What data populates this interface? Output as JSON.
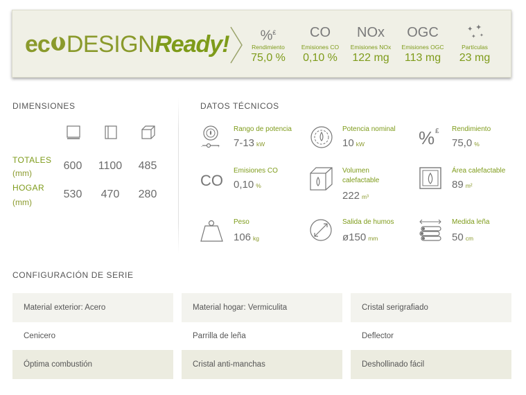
{
  "banner": {
    "logo": {
      "eco": "ec",
      "design": "DESIGN",
      "ready": "Ready!"
    },
    "stats": [
      {
        "symbol": "%",
        "label": "Rendimiento",
        "value": "75,0 %"
      },
      {
        "symbol": "CO",
        "label": "Emisiones CO",
        "value": "0,10 %"
      },
      {
        "symbol": "NOx",
        "label": "Emisiones NOx",
        "value": "122 mg"
      },
      {
        "symbol": "OGC",
        "label": "Emisiones OGC",
        "value": "113 mg"
      },
      {
        "symbol": "",
        "label": "Partículas",
        "value": "23 mg"
      }
    ]
  },
  "dimensions": {
    "title": "DIMENSIONES",
    "rows": [
      {
        "label": "TOTALES",
        "unit": "(mm)",
        "values": [
          "600",
          "1100",
          "485"
        ]
      },
      {
        "label": "HOGAR",
        "unit": "(mm)",
        "values": [
          "530",
          "470",
          "280"
        ]
      }
    ]
  },
  "tech": {
    "title": "DATOS TÉCNICOS",
    "items": [
      {
        "label": "Rango de potencia",
        "value": "7-13",
        "unit": "kW"
      },
      {
        "label": "Potencia nominal",
        "value": "10",
        "unit": "kW"
      },
      {
        "label": "Rendimiento",
        "value": "75,0",
        "unit": "%"
      },
      {
        "label": "Emisiones CO",
        "value": "0,10",
        "unit": "%",
        "symbol": "CO"
      },
      {
        "label": "Volumen calefactable",
        "value": "222",
        "unit": "m³"
      },
      {
        "label": "Área calefactable",
        "value": "89",
        "unit": "m²"
      },
      {
        "label": "Peso",
        "value": "106",
        "unit": "kg"
      },
      {
        "label": "Salida de humos",
        "value": "ø150",
        "unit": "mm"
      },
      {
        "label": "Medida leña",
        "value": "50",
        "unit": "cm"
      }
    ]
  },
  "config": {
    "title": "CONFIGURACIÓN DE SERIE",
    "items": [
      "Material exterior: Acero",
      "Material hogar: Vermiculita",
      "Cristal serigrafiado",
      "Cenicero",
      "Parrilla de leña",
      "Deflector",
      "Óptima combustión",
      "Cristal anti-manchas",
      "Deshollinado fácil"
    ]
  },
  "colors": {
    "accent": "#7e9b1a",
    "text": "#6b6b6b",
    "banner_bg": "#f0f0e6"
  }
}
